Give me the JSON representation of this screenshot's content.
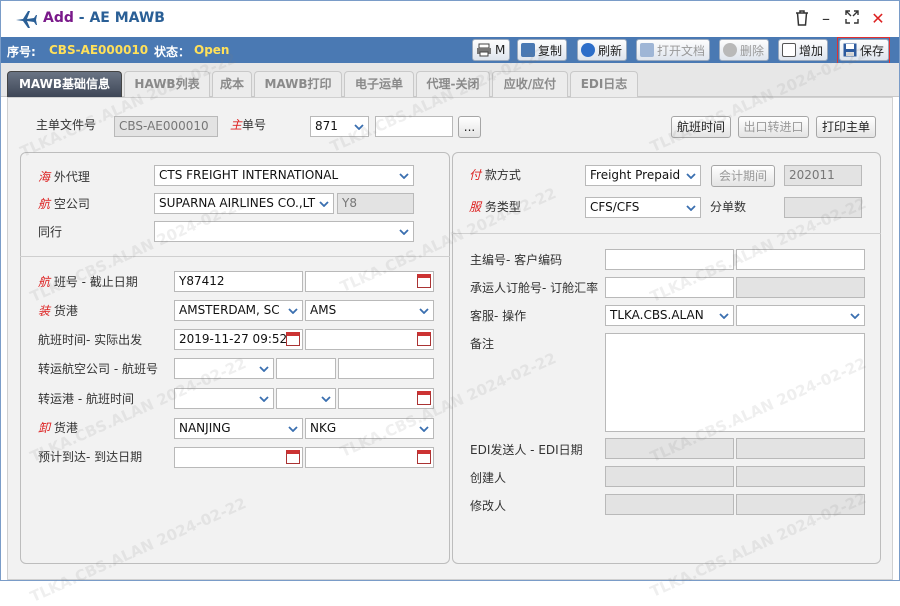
{
  "window": {
    "title_prefix": "Add",
    "title": "AE MAWB"
  },
  "info": {
    "seq_label": "序号:",
    "seq_value": "CBS-AE000010",
    "status_label": "状态：",
    "status_value": "Open"
  },
  "actions": {
    "print": "M",
    "copy": "复制",
    "refresh": "刷新",
    "open_doc": "打开文档",
    "delete": "删除",
    "add": "增加",
    "save": "保存"
  },
  "tabs": [
    "MAWB基础信息",
    "HAWB列表",
    "成本",
    "MAWB打印",
    "电子运单",
    "代理-关闭",
    "应收/应付",
    "EDI日志"
  ],
  "header": {
    "main_file_label": "主单文件号",
    "main_file_value": "CBS-AE000010",
    "master_no_accent": "主",
    "master_no_label": "单号",
    "master_prefix": "871",
    "master_no": "",
    "ellipsis": "...",
    "flight_time_btn": "航班时间",
    "export_transfer_btn": "出口转进口",
    "print_master_btn": "打印主单"
  },
  "left_top": {
    "overseas_agent_accent": "海",
    "overseas_agent_label": "外代理",
    "overseas_agent_value": "CTS FREIGHT INTERNATIONAL",
    "airline_accent": "航",
    "airline_label": "空公司",
    "airline_value": "SUPARNA AIRLINES CO.,LT",
    "airline_code": "Y8",
    "peer_label": "同行",
    "peer_value": ""
  },
  "left_bottom": {
    "flight_accent": "航",
    "flight_label": "班号 - 截止日期",
    "flight_no": "Y87412",
    "cutoff": "",
    "load_accent": "装",
    "load_label": "货港",
    "load_port": "AMSTERDAM, SC",
    "load_code": "AMS",
    "flight_time_label": "航班时间- 实际出发",
    "flight_time": "2019-11-27 09:52",
    "actual_dep": "",
    "transfer_airline_label": "转运航空公司 - 航班号",
    "transfer_port_label": "转运港 - 航班时间",
    "discharge_accent": "卸",
    "discharge_label": "货港",
    "discharge_port": "NANJING",
    "discharge_code": "NKG",
    "eta_label": "预计到达- 到达日期"
  },
  "right_top": {
    "payment_accent": "付",
    "payment_label": "款方式",
    "payment_value": "Freight Prepaid",
    "period_btn": "会计期间",
    "period_value": "202011",
    "service_accent": "服",
    "service_label": "务类型",
    "service_value": "CFS/CFS",
    "sub_count_label": "分单数",
    "sub_count_value": ""
  },
  "right_bottom": {
    "customer_code_label": "主编号- 客户编码",
    "booking_label": "承运人订舱号- 订舱汇率",
    "cs_label": "客服- 操作",
    "cs_value": "TLKA.CBS.ALAN",
    "remark_label": "备注",
    "edi_label": "EDI发送人 - EDI日期",
    "creator_label": "创建人",
    "modifier_label": "修改人"
  },
  "watermark": "TLKA.CBS.ALAN 2024-02-22",
  "colors": {
    "accent": "#4a79b3",
    "status": "#ffe05a",
    "required": "#d22222",
    "save_border": "#e03030"
  }
}
